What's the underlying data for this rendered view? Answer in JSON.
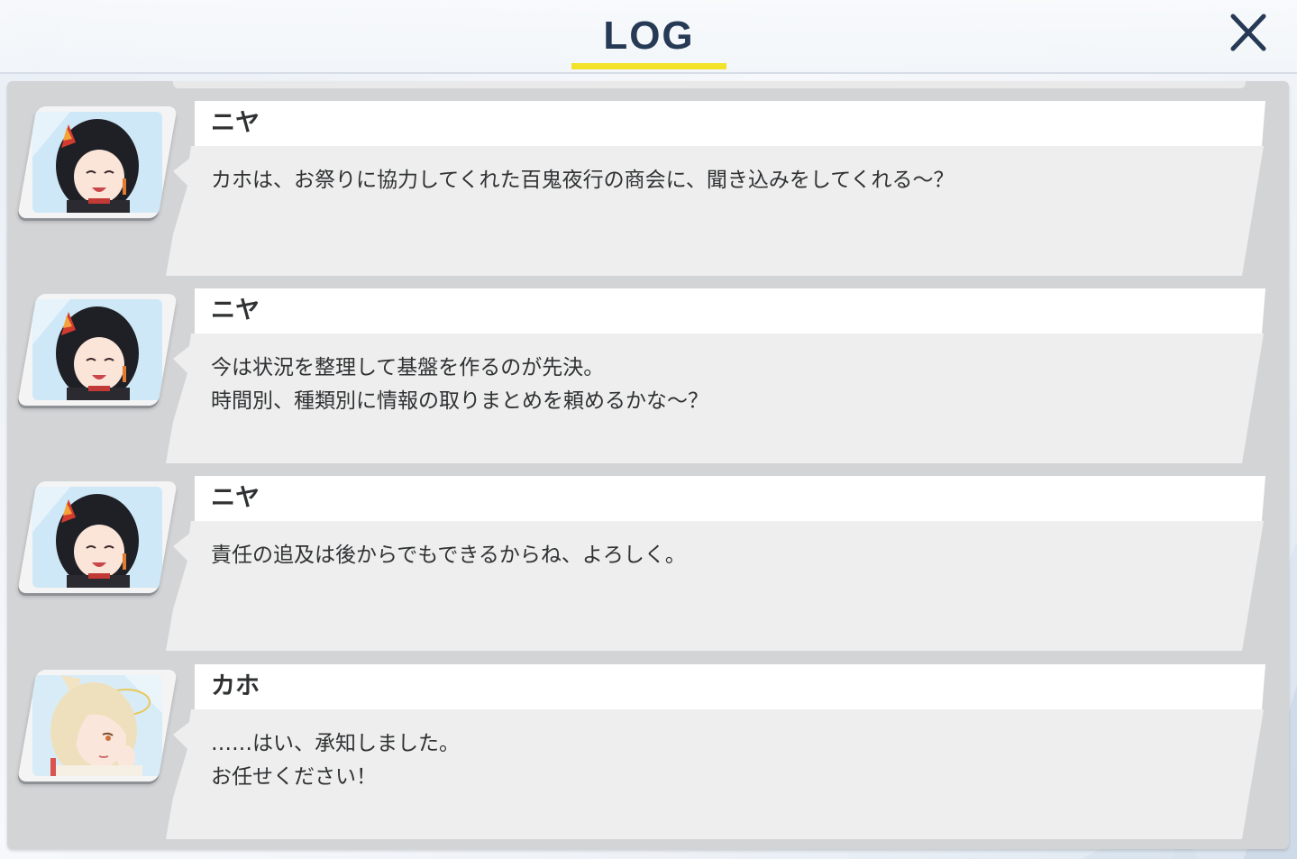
{
  "header": {
    "title": "LOG",
    "close_icon": "close-icon"
  },
  "colors": {
    "title": "#263a55",
    "underline": "#f3e22a",
    "panel": "#d3d4d6",
    "bubble_name": "#ffffff",
    "bubble_body": "#eeeeee",
    "text": "#2f3133"
  },
  "log": {
    "entries": [
      {
        "speaker": "ニヤ",
        "text": "カホは、お祭りに協力してくれた百鬼夜行の商会に、聞き込みをしてくれる～？",
        "portrait": "niya-portrait"
      },
      {
        "speaker": "ニヤ",
        "text": "今は状況を整理して基盤を作るのが先決。\n時間別、種類別に情報の取りまとめを頼めるかな～？",
        "portrait": "niya-portrait"
      },
      {
        "speaker": "ニヤ",
        "text": "責任の追及は後からでもできるからね、よろしく。",
        "portrait": "niya-portrait"
      },
      {
        "speaker": "カホ",
        "text": "……はい、承知しました。\nお任せください！",
        "portrait": "kaho-portrait"
      }
    ]
  }
}
